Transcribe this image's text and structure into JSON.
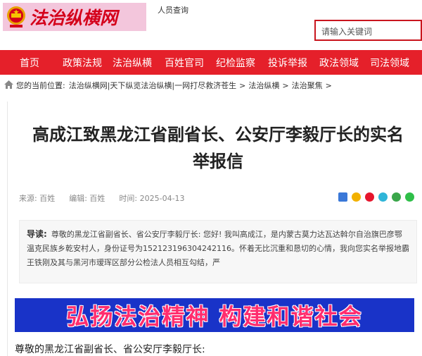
{
  "header": {
    "logo_text": "法治纵横网",
    "link": "人员查询",
    "search_placeholder": "请输入关键词"
  },
  "nav": [
    "首页",
    "政策法规",
    "法治纵横",
    "百姓官司",
    "纪检监察",
    "投诉举报",
    "政法领域",
    "司法领域"
  ],
  "breadcrumb": {
    "prefix": "您的当前位置:",
    "items": [
      "法治纵横网|天下纵览法治纵横|一网打尽救济苍生",
      "法治纵横",
      "法治聚焦"
    ],
    "separator": ">"
  },
  "article": {
    "title_line1": "高成江致黑龙江省副省长、公安厅李毅厅长的实名",
    "title_line2": "举报信",
    "source": "来源: 百姓",
    "editor": "编辑: 百姓",
    "time": "时间: 2025-04-13",
    "lead_label": "导读:",
    "lead_text": "尊敬的黑龙江省副省长、省公安厅李毅厅长: 您好! 我叫高成江，是内蒙古莫力达瓦达斡尔自治旗巴彦鄂温克民族乡乾安村人，身份证号为152123196304242116。怀着无比沉重和恳切的心情，我向您实名举报地霸王铁刚及其与黑河市瑷珲区部分公检法人员相互勾结，严",
    "banner_text": "弘扬法治精神 构建和谐社会",
    "salutation": "尊敬的黑龙江省副省长、省公安厅李毅厅长:"
  },
  "colors": {
    "brand_red": "#e5202a",
    "banner_blue": "#1933c8",
    "banner_text": "#ff2d6e"
  }
}
